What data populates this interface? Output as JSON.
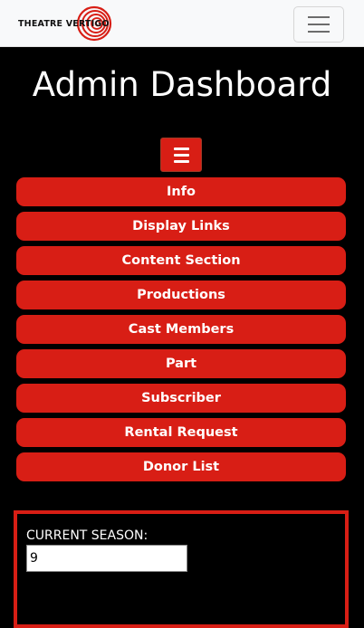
{
  "navbar": {
    "brand_text": "THEATRE VERTIGO",
    "logo_icon": "spiral-logo-icon",
    "menu_icon": "hamburger-icon"
  },
  "header": {
    "title": "Admin Dashboard"
  },
  "sidebar": {
    "toggle_icon": "hamburger-icon",
    "items": [
      {
        "label": "Info"
      },
      {
        "label": "Display Links"
      },
      {
        "label": "Content Section"
      },
      {
        "label": "Productions"
      },
      {
        "label": "Cast Members"
      },
      {
        "label": "Part"
      },
      {
        "label": "Subscriber"
      },
      {
        "label": "Rental Request"
      },
      {
        "label": "Donor List"
      }
    ]
  },
  "season": {
    "label": "CURRENT SEASON:",
    "value": "9"
  },
  "colors": {
    "accent": "#d81e15",
    "background": "#000000",
    "navbar": "#f8f9fa"
  }
}
